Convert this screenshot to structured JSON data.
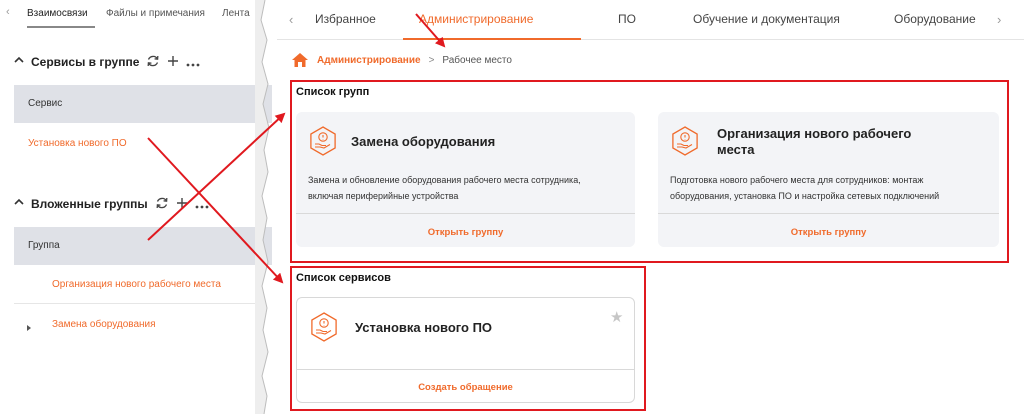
{
  "left_panel": {
    "tabs": [
      "Взаимосвязи",
      "Файлы и примечания",
      "Лента"
    ],
    "services_section": {
      "title": "Сервисы в группе",
      "column_header": "Сервис",
      "items": [
        "Установка нового ПО"
      ]
    },
    "nested_groups_section": {
      "title": "Вложенные группы",
      "column_header": "Группа",
      "items": [
        "Организация нового рабочего места",
        "Замена оборудования"
      ]
    }
  },
  "top_nav": {
    "items": [
      "Избранное",
      "Администрирование",
      "ПО",
      "Обучение и документация",
      "Оборудование"
    ],
    "active": "Администрирование"
  },
  "breadcrumb": {
    "current_section": "Администрирование",
    "separator": ">",
    "page": "Рабочее место"
  },
  "groups_section": {
    "title": "Список групп",
    "cards": [
      {
        "title": "Замена оборудования",
        "description_lines": [
          "Замена и обновление оборудования рабочего места сотрудника,",
          "включая периферийные устройства"
        ],
        "action": "Открыть группу"
      },
      {
        "title_lines": [
          "Организация нового рабочего",
          "места"
        ],
        "description_lines": [
          "Подготовка нового рабочего места для сотрудников: монтаж",
          "оборудования, установка ПО и настройка сетевых подключений"
        ],
        "action": "Открыть группу"
      }
    ]
  },
  "services_list": {
    "title": "Список сервисов",
    "cards": [
      {
        "title": "Установка нового ПО",
        "action": "Создать обращение"
      }
    ]
  },
  "colors": {
    "accent": "#f06a2b",
    "highlight_box": "#e0191f",
    "card_bg": "#f3f4f7",
    "row_bg": "#dfe1e7"
  },
  "icons": [
    "chevron-left-icon",
    "chevron-right-icon",
    "refresh-icon",
    "plus-icon",
    "more-icon",
    "caret-up-icon",
    "caret-right-icon",
    "home-icon",
    "service-hand-icon",
    "star-icon"
  ]
}
